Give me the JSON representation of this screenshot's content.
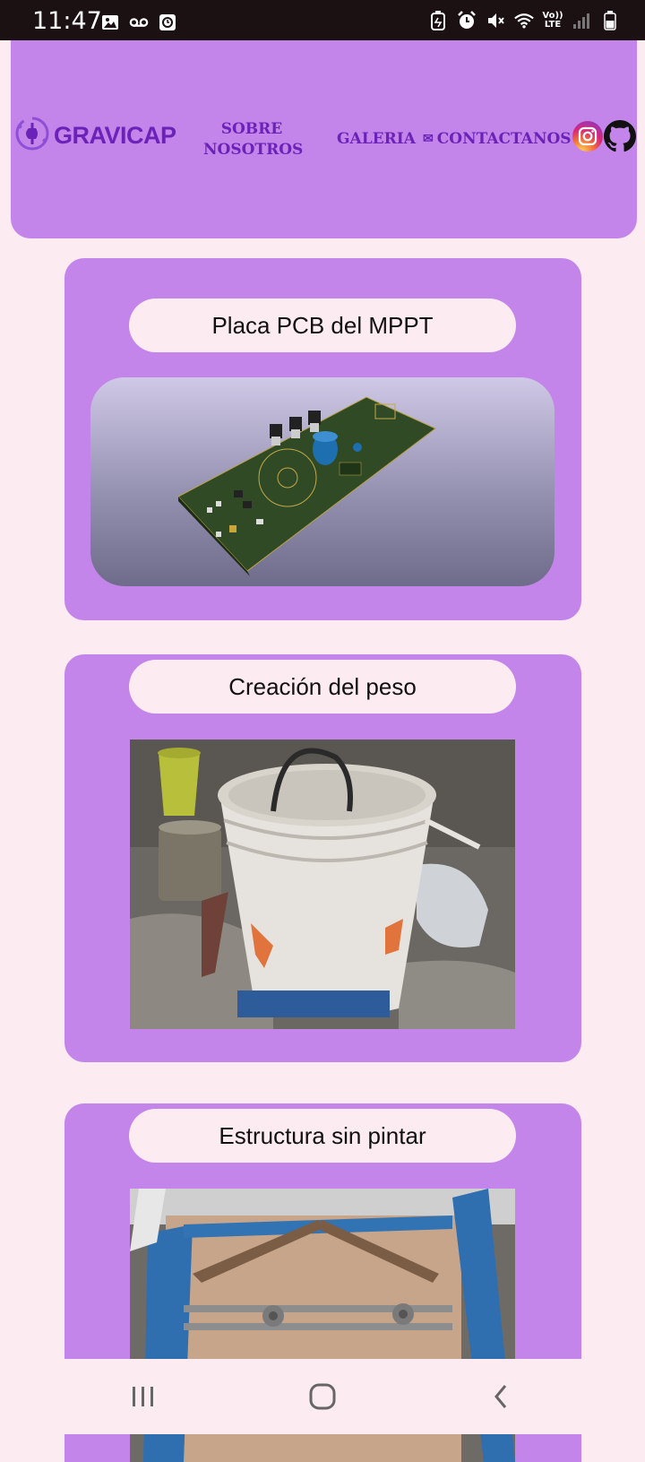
{
  "status_bar": {
    "time": "11:47",
    "left_icons": [
      "gallery-icon",
      "voicemail-icon",
      "clock-app-icon"
    ],
    "right_icons": [
      "battery-saver-icon",
      "alarm-icon",
      "mute-icon",
      "wifi-icon",
      "volte-icon",
      "signal-icon",
      "battery-icon"
    ],
    "network_label_top": "Vo))",
    "network_label_bottom": "LTE"
  },
  "header": {
    "logo_text": "GRAVICAP",
    "nav": {
      "about_line1": "SOBRE",
      "about_line2": "NOSOTROS",
      "gallery": "GALERIA",
      "contact": "CONTACTANOS"
    },
    "social_icons": [
      "instagram-icon",
      "github-icon"
    ],
    "accent_color": "#6a22b8",
    "background_color": "#c385e9"
  },
  "cards": [
    {
      "title": "Placa PCB del MPPT"
    },
    {
      "title": "Creación del peso"
    },
    {
      "title": "Estructura sin pintar"
    }
  ],
  "page_background": "#fcebf1",
  "nav_bar": {
    "icons": [
      "recent-apps-icon",
      "home-icon",
      "back-icon"
    ]
  }
}
